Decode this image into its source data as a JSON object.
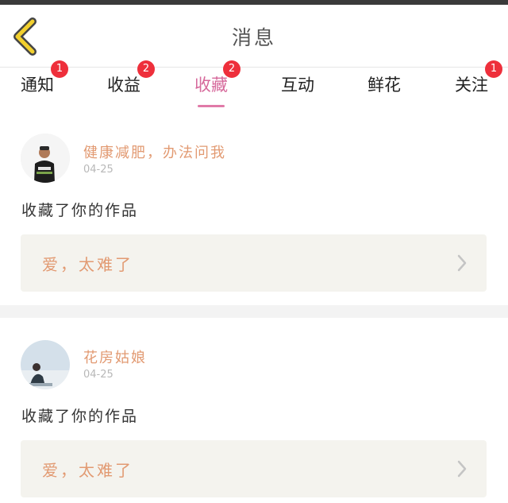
{
  "header": {
    "title": "消息",
    "back_icon": "chevron-left-icon",
    "accent_color": "#f2d02e"
  },
  "tabs": [
    {
      "label": "通知",
      "badge": "1",
      "active": false
    },
    {
      "label": "收益",
      "badge": "2",
      "active": false
    },
    {
      "label": "收藏",
      "badge": "2",
      "active": true
    },
    {
      "label": "互动",
      "badge": "",
      "active": false
    },
    {
      "label": "鲜花",
      "badge": "",
      "active": false
    },
    {
      "label": "关注",
      "badge": "1",
      "active": false
    }
  ],
  "colors": {
    "badge": "#ee2f3b",
    "active_tab": "#d6699b",
    "name": "#e29a72",
    "work_bg": "#f4f3ee"
  },
  "items": [
    {
      "user_name": "健康减肥，办法问我",
      "date": "04-25",
      "action": "收藏了你的作品",
      "work_title": "爱，太难了"
    },
    {
      "user_name": "花房姑娘",
      "date": "04-25",
      "action": "收藏了你的作品",
      "work_title": "爱，太难了"
    }
  ]
}
